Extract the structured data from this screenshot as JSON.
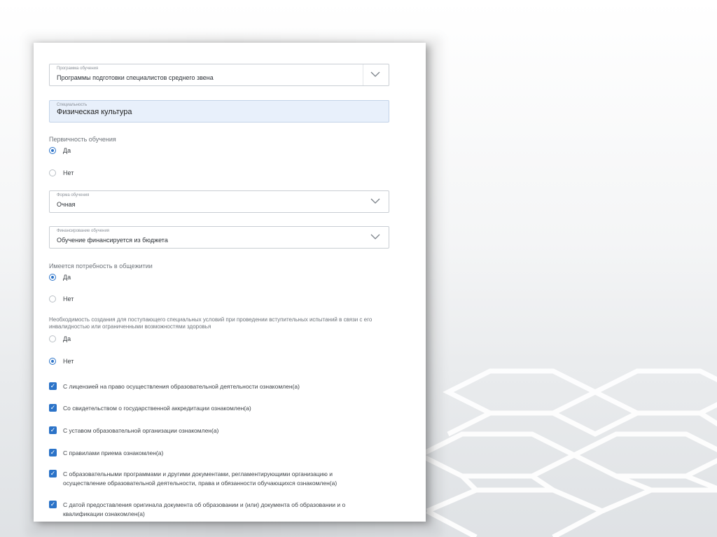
{
  "form": {
    "program": {
      "label": "Программа обучения",
      "value": "Программы подготовки специалистов среднего звена"
    },
    "specialty": {
      "label": "Специальность",
      "value": "Физическая культура"
    },
    "primary": {
      "question": "Первичность обучения",
      "options": [
        "Да",
        "Нет"
      ],
      "selected": "Да"
    },
    "study_form": {
      "label": "Форма обучения",
      "value": "Очная"
    },
    "funding": {
      "label": "Финансирование обучения",
      "value": "Обучение финансируется из бюджета"
    },
    "dormitory": {
      "question": "Имеется потребность в общежитии",
      "options": [
        "Да",
        "Нет"
      ],
      "selected": "Да"
    },
    "special_conditions": {
      "question": "Необходимость создания для поступающего специальных условий при проведении вступительных испытаний в связи с его инвалидностью или ограниченными возможностями здоровья",
      "options": [
        "Да",
        "Нет"
      ],
      "selected": "Нет"
    },
    "acknowledgements": [
      "С лицензией на право осуществления образовательной деятельности ознакомлен(а)",
      "Со свидетельством о государственной аккредитации ознакомлен(а)",
      "С уставом образовательной организации ознакомлен(а)",
      "С правилами приема ознакомлен(а)",
      "С образовательными программами и другими документами, регламентирующими организацию и осуществление образовательной деятельности, права и обязанности обучающихся ознакомлен(а)",
      "С датой предоставления оригинала документа об образовании и (или) документа об образовании и о квалификации ознакомлен(а)"
    ]
  },
  "colors": {
    "accent": "#2b73c8",
    "filled_field": "#e8f0fb",
    "border": "#c9ced3"
  },
  "icons": {
    "dropdown": "chevron-down-icon",
    "checkbox": "checkmark-icon"
  }
}
